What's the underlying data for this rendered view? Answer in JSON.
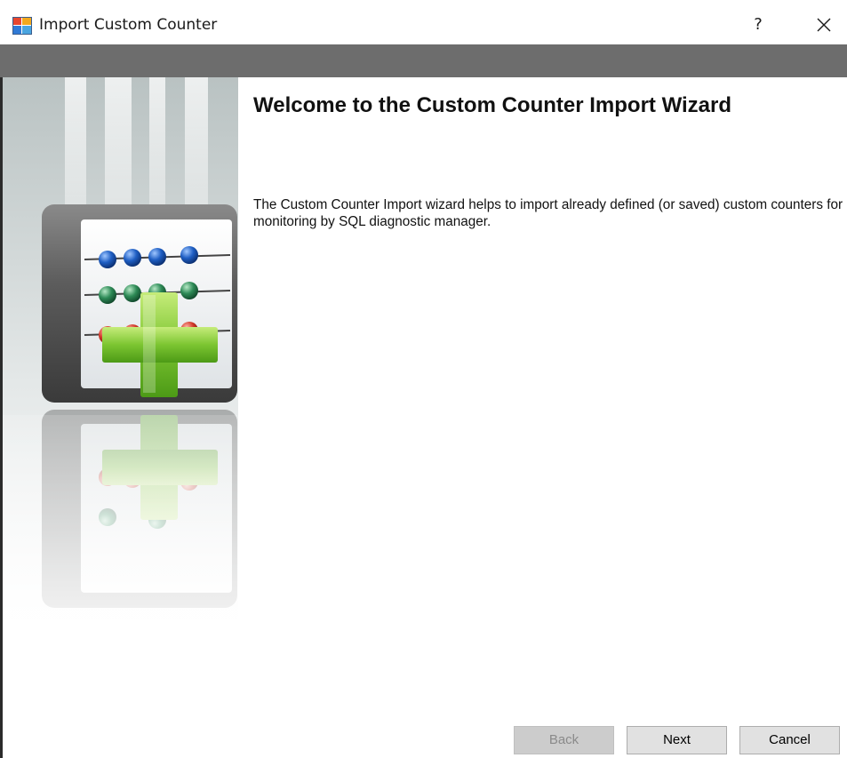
{
  "window": {
    "title": "Import Custom Counter",
    "help_label": "?",
    "close_icon": "close-icon"
  },
  "wizard": {
    "heading": "Welcome to the Custom Counter Import Wizard",
    "description": "The Custom Counter Import wizard helps to import already defined (or saved) custom counters for monitoring by SQL diagnostic manager.",
    "illustration": "abacus-plus-icon"
  },
  "buttons": {
    "back_label": "Back",
    "next_label": "Next",
    "cancel_label": "Cancel",
    "back_enabled": false
  },
  "colors": {
    "header_band": "#6d6d6d",
    "bead_blue": "#1f5fc4",
    "bead_green": "#2e8b57",
    "bead_red": "#d23a2a",
    "plus_green": "#7cc531"
  }
}
